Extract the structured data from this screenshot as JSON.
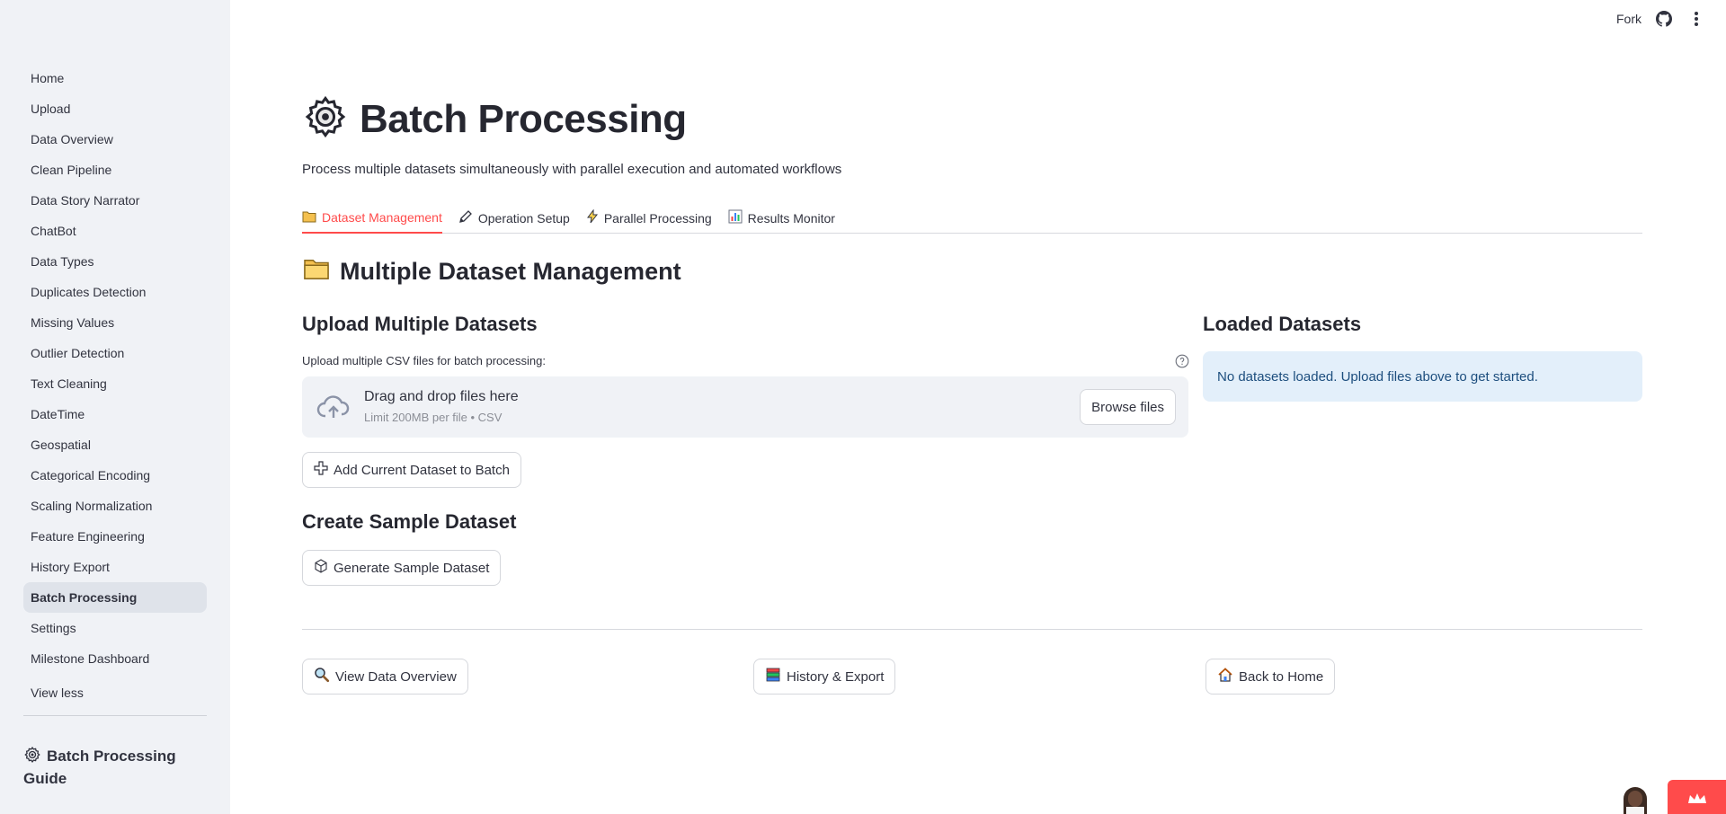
{
  "sidebar": {
    "items": [
      {
        "label": "Home"
      },
      {
        "label": "Upload"
      },
      {
        "label": "Data Overview"
      },
      {
        "label": "Clean Pipeline"
      },
      {
        "label": "Data Story Narrator"
      },
      {
        "label": "ChatBot"
      },
      {
        "label": "Data Types"
      },
      {
        "label": "Duplicates Detection"
      },
      {
        "label": "Missing Values"
      },
      {
        "label": "Outlier Detection"
      },
      {
        "label": "Text Cleaning"
      },
      {
        "label": "DateTime"
      },
      {
        "label": "Geospatial"
      },
      {
        "label": "Categorical Encoding"
      },
      {
        "label": "Scaling Normalization"
      },
      {
        "label": "Feature Engineering"
      },
      {
        "label": "History Export"
      },
      {
        "label": "Batch Processing"
      },
      {
        "label": "Settings"
      },
      {
        "label": "Milestone Dashboard"
      }
    ],
    "active_item": "Batch Processing",
    "view_less": "View less",
    "guide_title": "Batch Processing Guide"
  },
  "header": {
    "fork": "Fork",
    "icons": [
      "github-icon",
      "more-vert-icon"
    ]
  },
  "page": {
    "title": "Batch Processing",
    "subtitle": "Process multiple datasets simultaneously with parallel execution and automated workflows",
    "tabs": [
      {
        "label": "Dataset Management",
        "icon": "folder-icon",
        "active": true
      },
      {
        "label": "Operation Setup",
        "icon": "pencil-icon",
        "active": false
      },
      {
        "label": "Parallel Processing",
        "icon": "lightning-icon",
        "active": false
      },
      {
        "label": "Results Monitor",
        "icon": "bar-chart-icon",
        "active": false
      }
    ],
    "section_title": "Multiple Dataset Management",
    "upload": {
      "heading": "Upload Multiple Datasets",
      "label": "Upload multiple CSV files for batch processing:",
      "drop_title": "Drag and drop files here",
      "drop_sub": "Limit 200MB per file • CSV",
      "browse": "Browse files"
    },
    "add_current": "Add Current Dataset to Batch",
    "sample": {
      "heading": "Create Sample Dataset",
      "button": "Generate Sample Dataset"
    },
    "loaded": {
      "heading": "Loaded Datasets",
      "empty_message": "No datasets loaded. Upload files above to get started."
    },
    "footer_buttons": {
      "view_overview": "View Data Overview",
      "history_export": "History & Export",
      "back_home": "Back to Home"
    }
  },
  "colors": {
    "accent": "#ff4b4b",
    "sidebar_bg": "#f0f2f6",
    "info_bg": "#e3effa",
    "info_text": "#1d4e7e"
  }
}
